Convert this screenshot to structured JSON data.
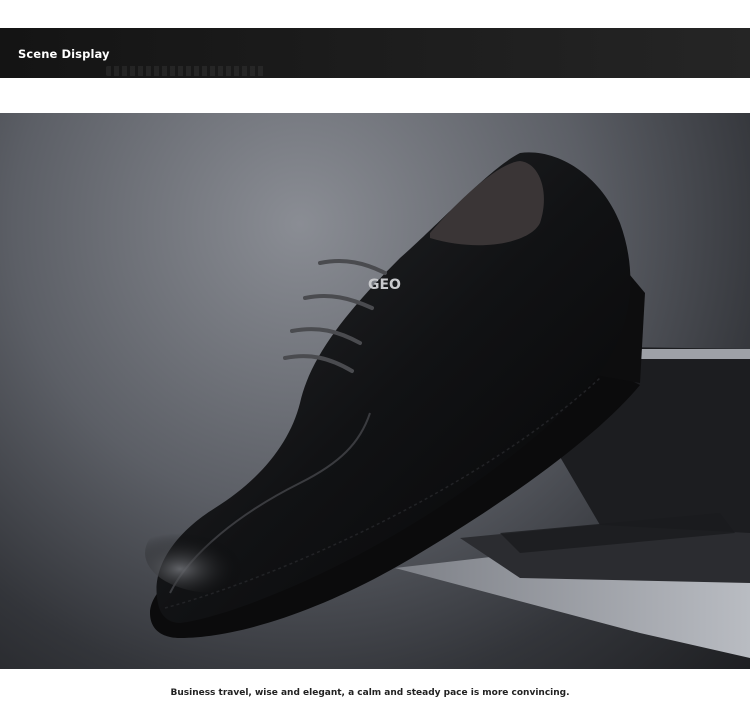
{
  "header": {
    "title": "Scene Display"
  },
  "scene": {
    "alt": "Black leather lace-up dress shoe on a laptop",
    "logo_text": "GEO"
  },
  "caption": {
    "text": "Business travel, wise and elegant, a calm and steady pace is more convincing."
  }
}
